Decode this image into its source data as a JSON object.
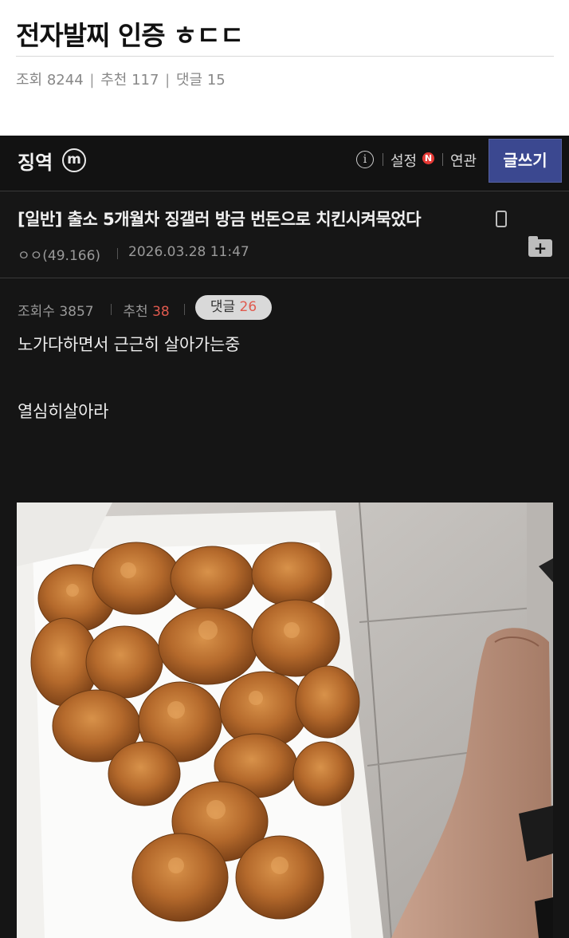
{
  "post": {
    "title": "전자발찌 인증 ㅎㄷㄷ",
    "views_label": "조회",
    "views": "8244",
    "likes_label": "추천",
    "likes": "117",
    "comments_label": "댓글",
    "comments": "15",
    "separator": "|"
  },
  "screenshot": {
    "topbar": {
      "gallery_name": "징역",
      "gallery_icon": "m",
      "info_icon": "i",
      "settings_label": "설정",
      "new_badge": "N",
      "related_label": "연관",
      "write_button": "글쓰기"
    },
    "article": {
      "title": "[일반] 출소 5개월차 징갤러 방금 번돈으로 치킨시켜묵었다",
      "author": "ㅇㅇ(49.166)",
      "date": "2026.03.28 11:47",
      "views_label": "조회수",
      "views": "3857",
      "likes_label": "추천",
      "likes": "38",
      "comments_label": "댓글",
      "comments": "26",
      "folder_icon": "+",
      "body": [
        "노가다하면서 근근히 살아가는중",
        "열심히살아라"
      ]
    },
    "colors": {
      "background": "#151515",
      "write_button": "#3b4890",
      "accent_red": "#e05a4e",
      "new_badge": "#e53935"
    },
    "icons": [
      "m-circle-icon",
      "info-icon",
      "new-badge-icon",
      "mobile-phone-icon",
      "folder-add-icon"
    ]
  }
}
